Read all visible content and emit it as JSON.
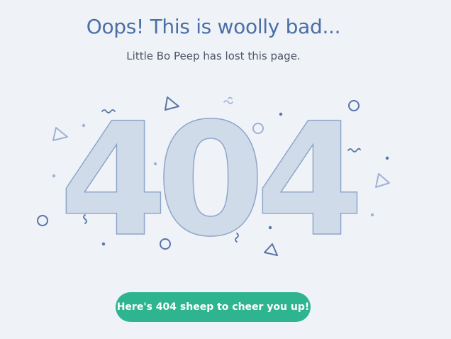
{
  "heading": "Oops! This is woolly bad...",
  "subheading": "Little Bo Peep has lost this page.",
  "error_code": {
    "first": "4",
    "middle": "0",
    "last": "4"
  },
  "cta_label": "Here's 404 sheep to cheer you up!",
  "colors": {
    "background": "#eff2f7",
    "heading": "#4a6fa5",
    "digit_fill": "#d0dbea",
    "digit_stroke": "#8ea5c9",
    "confetti": "#6f89b7",
    "button": "#2eb48e"
  },
  "decorations": [
    "triangle-icon",
    "circle-icon",
    "squiggle-icon",
    "dot-icon"
  ]
}
